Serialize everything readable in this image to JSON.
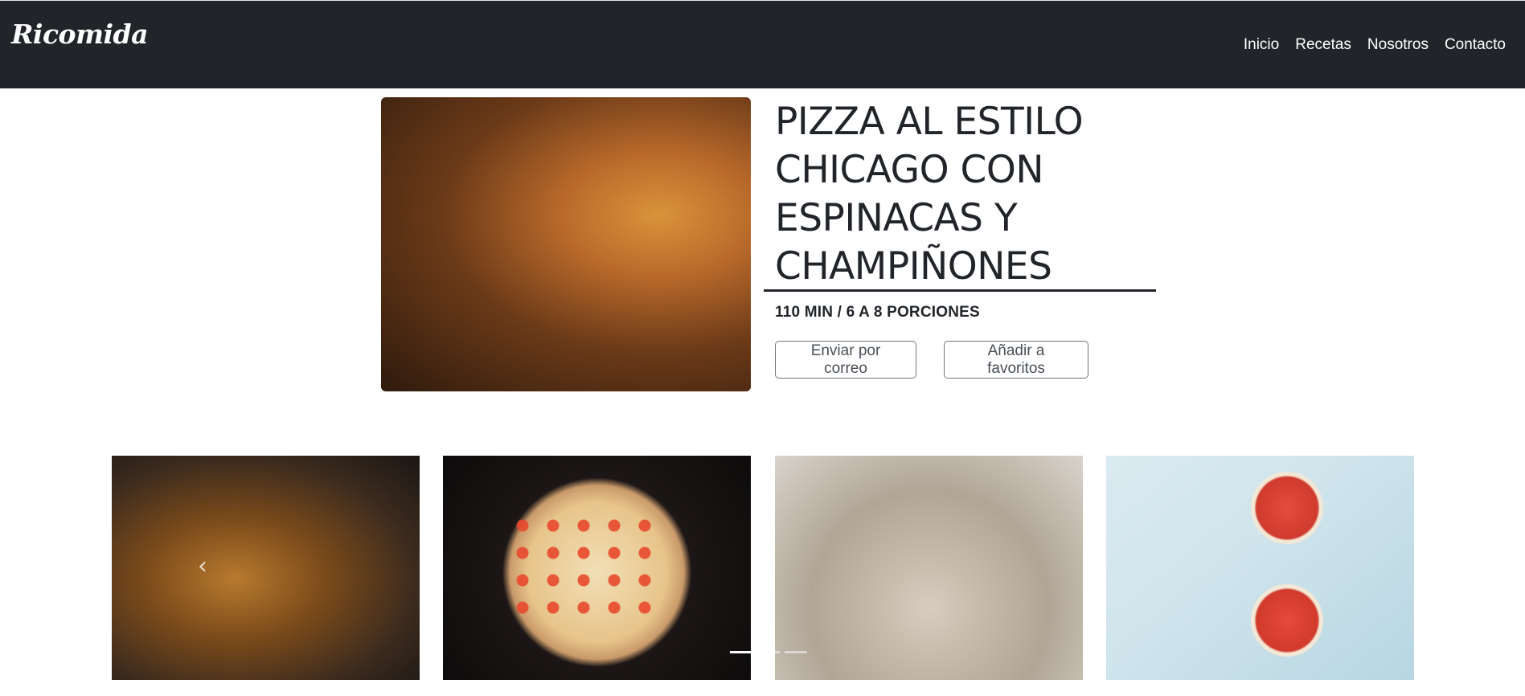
{
  "navbar": {
    "brand": "Ricomida",
    "links": [
      "Inicio",
      "Recetas",
      "Nosotros",
      "Contacto"
    ]
  },
  "hero": {
    "image_alt": "pizza-image",
    "title": "PIZZA AL ESTILO CHICAGO CON ESPINACAS Y CHAMPIÑONES",
    "meta": "110 MIN / 6 A 8 PORCIONES",
    "email_button": "Enviar por correo",
    "favorite_button": "Añadir a favoritos"
  },
  "gallery": {
    "items": [
      "mushrooms-image",
      "pizza-oven-image",
      "dough-image",
      "pizza-preparation-image"
    ],
    "prev_icon": "chevron-left-icon",
    "indicators": 3,
    "active_indicator": 0
  },
  "colors": {
    "navbar_bg": "#212529",
    "text": "#212529",
    "button_border": "#6c757d"
  }
}
